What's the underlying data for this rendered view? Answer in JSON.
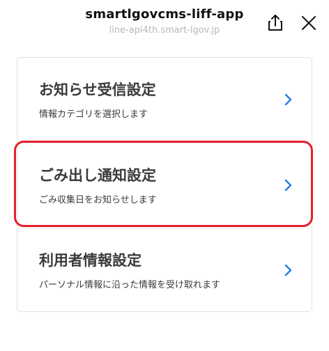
{
  "header": {
    "title": "smartlgovcms-liff-app",
    "subtitle": "line-api4th.smart-lgov.jp",
    "share_icon": "share-icon",
    "close_icon": "close-icon"
  },
  "menu": {
    "items": [
      {
        "title": "お知らせ受信設定",
        "description": "情報カテゴリを選択します",
        "icon": "chevron-right-icon"
      },
      {
        "title": "ごみ出し通知設定",
        "description": "ごみ収集日をお知らせします",
        "icon": "chevron-right-icon"
      },
      {
        "title": "利用者情報設定",
        "description": "パーソナル情報に沿った情報を受け取れます",
        "icon": "chevron-right-icon"
      }
    ]
  },
  "colors": {
    "chevron": "#2a7de1",
    "highlight": "#e5202c"
  }
}
